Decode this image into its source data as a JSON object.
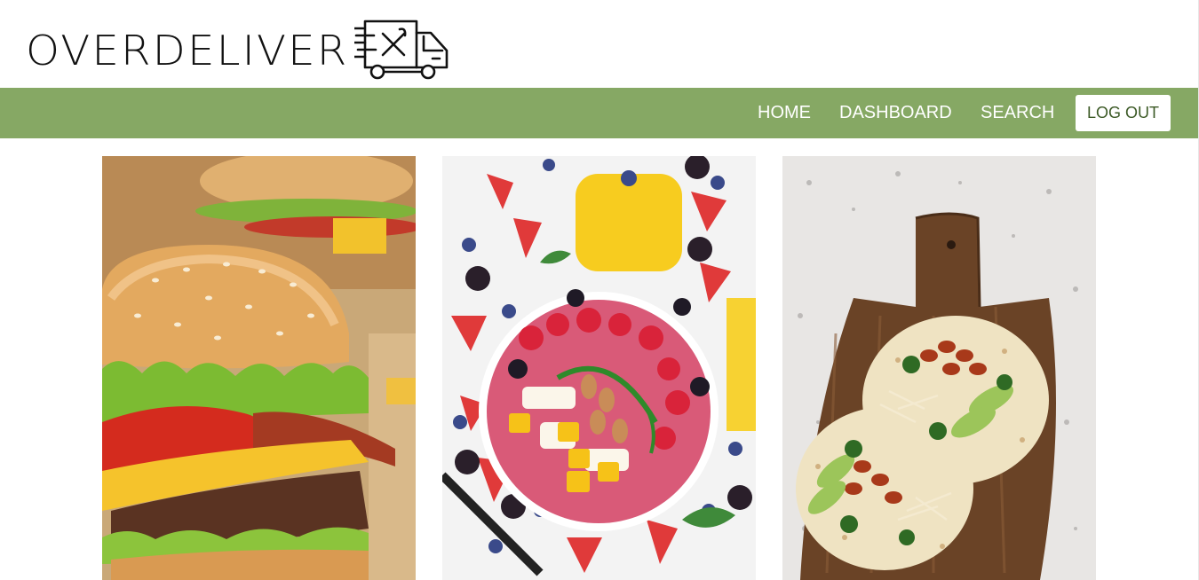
{
  "brand": {
    "name": "OVERDELIVER",
    "logo_icon": "delivery-truck-icon"
  },
  "nav": {
    "items": [
      "HOME",
      "DASHBOARD",
      "SEARCH"
    ],
    "logout_label": "LOG OUT"
  },
  "colors": {
    "nav_background": "#86a864",
    "nav_text": "#ffffff",
    "logout_text": "#3c5a26"
  },
  "gallery": [
    {
      "subject": "burger"
    },
    {
      "subject": "smoothie-bowl"
    },
    {
      "subject": "tacos"
    }
  ]
}
